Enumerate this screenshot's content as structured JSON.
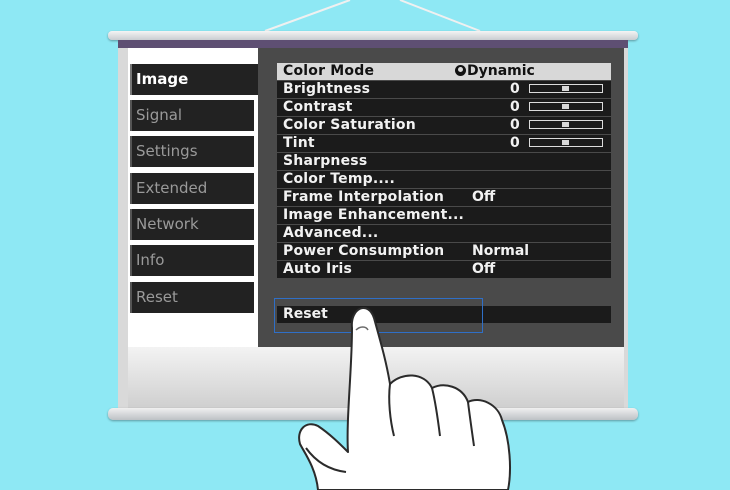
{
  "colors": {
    "background": "#8ee8f4",
    "menu_bg": "#4a4a4a",
    "row_bg": "#1b1b1b",
    "selected_row_bg": "#d8d8d8",
    "highlight_frame": "#2f6fc7"
  },
  "sidebar": {
    "tabs": [
      {
        "label": "Image",
        "active": true
      },
      {
        "label": "Signal"
      },
      {
        "label": "Settings"
      },
      {
        "label": "Extended"
      },
      {
        "label": "Network"
      },
      {
        "label": "Info"
      },
      {
        "label": "Reset"
      }
    ]
  },
  "menu": {
    "color_mode": {
      "label": "Color Mode",
      "value": "Dynamic"
    },
    "brightness": {
      "label": "Brightness",
      "value": "0"
    },
    "contrast": {
      "label": "Contrast",
      "value": "0"
    },
    "color_saturation": {
      "label": "Color Saturation",
      "value": "0"
    },
    "tint": {
      "label": "Tint",
      "value": "0"
    },
    "sharpness": {
      "label": "Sharpness"
    },
    "color_temp": {
      "label": "Color Temp...."
    },
    "frame_interpolation": {
      "label": "Frame Interpolation",
      "value": "Off"
    },
    "image_enhancement": {
      "label": "Image Enhancement..."
    },
    "advanced": {
      "label": "Advanced..."
    },
    "power_consumption": {
      "label": "Power Consumption",
      "value": "Normal"
    },
    "auto_iris": {
      "label": "Auto Iris",
      "value": "Off"
    },
    "reset": {
      "label": "Reset"
    }
  }
}
